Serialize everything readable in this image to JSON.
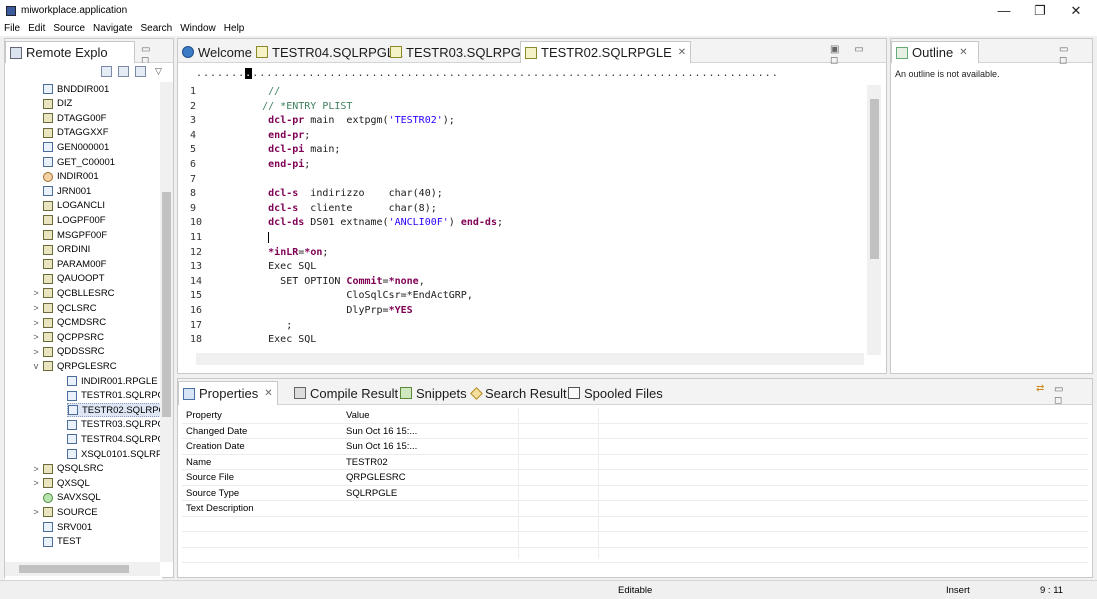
{
  "window": {
    "title": "miworkplace.application",
    "minimize": "—",
    "restore": "❐",
    "close": "✕"
  },
  "menu": [
    "File",
    "Edit",
    "Source",
    "Navigate",
    "Search",
    "Window",
    "Help"
  ],
  "explorer": {
    "tab_label": "Remote Explo",
    "minmax": "▭ ◻",
    "tree": [
      {
        "label": "BNDDIR001",
        "type": "file",
        "twisty": ""
      },
      {
        "label": "DIZ",
        "type": "lib",
        "twisty": ""
      },
      {
        "label": "DTAGG00F",
        "type": "lib",
        "twisty": ""
      },
      {
        "label": "DTAGGXXF",
        "type": "lib",
        "twisty": ""
      },
      {
        "label": "GEN000001",
        "type": "file",
        "twisty": ""
      },
      {
        "label": "GET_C00001",
        "type": "file",
        "twisty": ""
      },
      {
        "label": "INDIR001",
        "type": "gear",
        "twisty": ""
      },
      {
        "label": "JRN001",
        "type": "file",
        "twisty": ""
      },
      {
        "label": "LOGANCLI",
        "type": "lib",
        "twisty": ""
      },
      {
        "label": "LOGPF00F",
        "type": "lib",
        "twisty": ""
      },
      {
        "label": "MSGPF00F",
        "type": "lib",
        "twisty": ""
      },
      {
        "label": "ORDINI",
        "type": "lib",
        "twisty": ""
      },
      {
        "label": "PARAM00F",
        "type": "lib",
        "twisty": ""
      },
      {
        "label": "QAUOOPT",
        "type": "lib",
        "twisty": ""
      },
      {
        "label": "QCBLLESRC",
        "type": "lib",
        "twisty": ">"
      },
      {
        "label": "QCLSRC",
        "type": "lib",
        "twisty": ">"
      },
      {
        "label": "QCMDSRC",
        "type": "lib",
        "twisty": ">"
      },
      {
        "label": "QCPPSRC",
        "type": "lib",
        "twisty": ">"
      },
      {
        "label": "QDDSSRC",
        "type": "lib",
        "twisty": ">"
      },
      {
        "label": "QRPGLESRC",
        "type": "lib",
        "twisty": "v"
      },
      {
        "label": "INDIR001.RPGLE",
        "type": "file",
        "twisty": "",
        "child": true
      },
      {
        "label": "TESTR01.SQLRPG",
        "type": "file",
        "twisty": "",
        "child": true
      },
      {
        "label": "TESTR02.SQLRPG",
        "type": "file",
        "twisty": "",
        "child": true,
        "selected": true
      },
      {
        "label": "TESTR03.SQLRPG",
        "type": "file",
        "twisty": "",
        "child": true
      },
      {
        "label": "TESTR04.SQLRPG",
        "type": "file",
        "twisty": "",
        "child": true
      },
      {
        "label": "XSQL0101.SQLRP",
        "type": "file",
        "twisty": "",
        "child": true
      },
      {
        "label": "QSQLSRC",
        "type": "lib",
        "twisty": ">"
      },
      {
        "label": "QXSQL",
        "type": "lib",
        "twisty": ">"
      },
      {
        "label": "SAVXSQL",
        "type": "prog",
        "twisty": ""
      },
      {
        "label": "SOURCE",
        "type": "lib",
        "twisty": ">"
      },
      {
        "label": "SRV001",
        "type": "file",
        "twisty": ""
      },
      {
        "label": "TEST",
        "type": "file",
        "twisty": ""
      }
    ]
  },
  "editor": {
    "tabs": [
      {
        "label": "Welcome",
        "icon": "globe-icon",
        "active": false
      },
      {
        "label": "TESTR04.SQLRPGLE",
        "icon": "source-file-icon",
        "active": false
      },
      {
        "label": "TESTR03.SQLRPGLE",
        "icon": "source-file-icon",
        "active": false
      },
      {
        "label": "TESTR02.SQLRPGLE",
        "icon": "source-file-icon",
        "active": true
      }
    ],
    "close_glyph": "✕",
    "ruler_before": ".......",
    "ruler_cursor": ".",
    "ruler_after": "...........................................................................",
    "lines": [
      {
        "n": "1",
        "segs": [
          {
            "t": "       "
          },
          {
            "t": "//",
            "c": "com"
          }
        ]
      },
      {
        "n": "2",
        "segs": [
          {
            "t": "      "
          },
          {
            "t": "// *ENTRY PLIST",
            "c": "com"
          }
        ]
      },
      {
        "n": "3",
        "segs": [
          {
            "t": "       "
          },
          {
            "t": "dcl-pr",
            "c": "kw"
          },
          {
            "t": " main  extpgm("
          },
          {
            "t": "'TESTR02'",
            "c": "str"
          },
          {
            "t": ");"
          }
        ]
      },
      {
        "n": "4",
        "segs": [
          {
            "t": "       "
          },
          {
            "t": "end-pr",
            "c": "kw"
          },
          {
            "t": ";"
          }
        ]
      },
      {
        "n": "5",
        "segs": [
          {
            "t": "       "
          },
          {
            "t": "dcl-pi",
            "c": "kw"
          },
          {
            "t": " main;"
          }
        ]
      },
      {
        "n": "6",
        "segs": [
          {
            "t": "       "
          },
          {
            "t": "end-pi",
            "c": "kw"
          },
          {
            "t": ";"
          }
        ]
      },
      {
        "n": "7",
        "segs": [
          {
            "t": ""
          }
        ]
      },
      {
        "n": "8",
        "segs": [
          {
            "t": "       "
          },
          {
            "t": "dcl-s",
            "c": "kw"
          },
          {
            "t": "  indirizzo    char(40);"
          }
        ]
      },
      {
        "n": "9",
        "segs": [
          {
            "t": "       "
          },
          {
            "t": "dcl-s",
            "c": "kw"
          },
          {
            "t": "  cliente      char(8);"
          }
        ]
      },
      {
        "n": "10",
        "segs": [
          {
            "t": "       "
          },
          {
            "t": "dcl-ds",
            "c": "kw"
          },
          {
            "t": " DS01 extname("
          },
          {
            "t": "'ANCLI00F'",
            "c": "str"
          },
          {
            "t": ") "
          },
          {
            "t": "end-ds",
            "c": "kw"
          },
          {
            "t": ";"
          }
        ]
      },
      {
        "n": "11",
        "segs": [
          {
            "t": "       "
          },
          {
            "t": "",
            "caret": true
          }
        ]
      },
      {
        "n": "12",
        "segs": [
          {
            "t": "       "
          },
          {
            "t": "*inLR",
            "c": "kw"
          },
          {
            "t": "="
          },
          {
            "t": "*on",
            "c": "kw"
          },
          {
            "t": ";"
          }
        ]
      },
      {
        "n": "13",
        "segs": [
          {
            "t": "       Exec SQL"
          }
        ]
      },
      {
        "n": "14",
        "segs": [
          {
            "t": "         SET OPTION "
          },
          {
            "t": "Commit",
            "c": "kw"
          },
          {
            "t": "="
          },
          {
            "t": "*none",
            "c": "kw"
          },
          {
            "t": ","
          }
        ]
      },
      {
        "n": "15",
        "segs": [
          {
            "t": "                    CloSqlCsr=*EndActGRP,"
          }
        ]
      },
      {
        "n": "16",
        "segs": [
          {
            "t": "                    DlyPrp="
          },
          {
            "t": "*YES",
            "c": "kw"
          }
        ]
      },
      {
        "n": "17",
        "segs": [
          {
            "t": "          ;"
          }
        ]
      },
      {
        "n": "18",
        "segs": [
          {
            "t": "       Exec SQL"
          }
        ]
      }
    ]
  },
  "outline": {
    "tab_label": "Outline",
    "close_glyph": "✕",
    "message": "An outline is not available."
  },
  "bottom": {
    "tabs": [
      {
        "label": "Properties",
        "icon": "properties-icon",
        "closable": true
      },
      {
        "label": "Compile Result",
        "icon": "compile-icon",
        "closable": false
      },
      {
        "label": "Snippets",
        "icon": "snippets-icon",
        "closable": false
      },
      {
        "label": "Search Result",
        "icon": "search-icon",
        "closable": false
      },
      {
        "label": "Spooled Files",
        "icon": "spool-icon",
        "closable": false
      }
    ],
    "close_glyph": "✕",
    "header": {
      "property": "Property",
      "value": "Value"
    },
    "rows": [
      {
        "property": "Changed Date",
        "value": "Sun Oct 16 15:..."
      },
      {
        "property": "Creation Date",
        "value": "Sun Oct 16 15:..."
      },
      {
        "property": "Name",
        "value": "TESTR02"
      },
      {
        "property": "Source File",
        "value": "QRPGLESRC"
      },
      {
        "property": "Source Type",
        "value": "SQLRPGLE"
      },
      {
        "property": "Text Description",
        "value": ""
      },
      {
        "property": "",
        "value": ""
      },
      {
        "property": "",
        "value": ""
      },
      {
        "property": "",
        "value": ""
      }
    ]
  },
  "status": {
    "mode": "Editable",
    "insert": "Insert",
    "position": "9 : 11"
  }
}
